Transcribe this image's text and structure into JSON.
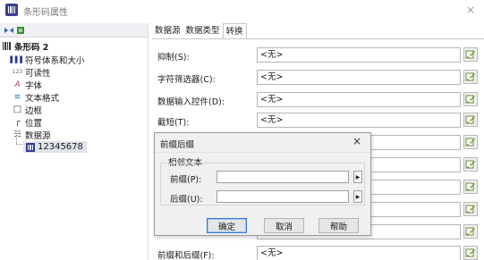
{
  "window": {
    "title": "条形码属性",
    "close_label": "×"
  },
  "tree": {
    "root_label": "条形码 2",
    "items": [
      {
        "label": "符号体系和大小",
        "icon": "barcode-bars-icon",
        "glyph": "▌▌▌"
      },
      {
        "label": "可读性",
        "icon": "readability-icon",
        "glyph": "123"
      },
      {
        "label": "字体",
        "icon": "font-icon",
        "glyph": "A"
      },
      {
        "label": "文本格式",
        "icon": "text-format-icon",
        "glyph": "≡"
      },
      {
        "label": "边框",
        "icon": "border-icon",
        "glyph": "□"
      },
      {
        "label": "位置",
        "icon": "position-icon",
        "glyph": "┌"
      },
      {
        "label": "数据源",
        "icon": "data-source-icon",
        "glyph": "☷"
      }
    ],
    "selected_item": {
      "label": "12345678",
      "icon": "barcode-item-icon"
    }
  },
  "tabs": [
    {
      "label": "数据源",
      "active": false
    },
    {
      "label": "数据类型",
      "active": false
    },
    {
      "label": "转换",
      "active": true
    }
  ],
  "properties": [
    {
      "label": "抑制(S):",
      "value": "<无>"
    },
    {
      "label": "字符筛选器(C):",
      "value": "<无>"
    },
    {
      "label": "数据输入控件(D):",
      "value": "<无>"
    },
    {
      "label": "截短(T):",
      "value": "<无>"
    },
    {
      "label": "",
      "value": ""
    },
    {
      "label": "",
      "value": ""
    },
    {
      "label": "",
      "value": ""
    },
    {
      "label": "",
      "value": ""
    },
    {
      "label": "",
      "value": ""
    },
    {
      "label": "前缀和后缀(F):",
      "value": "<无>"
    }
  ],
  "dialog": {
    "title": "前缀后缀",
    "close_label": "×",
    "group_label": "相邻文本",
    "prefix_label": "前缀(P):",
    "prefix_value": "",
    "suffix_label": "后缀(U):",
    "suffix_value": "",
    "ok_label": "确定",
    "cancel_label": "取消",
    "help_label": "帮助"
  },
  "colors": {
    "accent": "#3a78d4",
    "tree_icon": "#2b3a8a",
    "selected_bg": "#dfe3ea"
  }
}
